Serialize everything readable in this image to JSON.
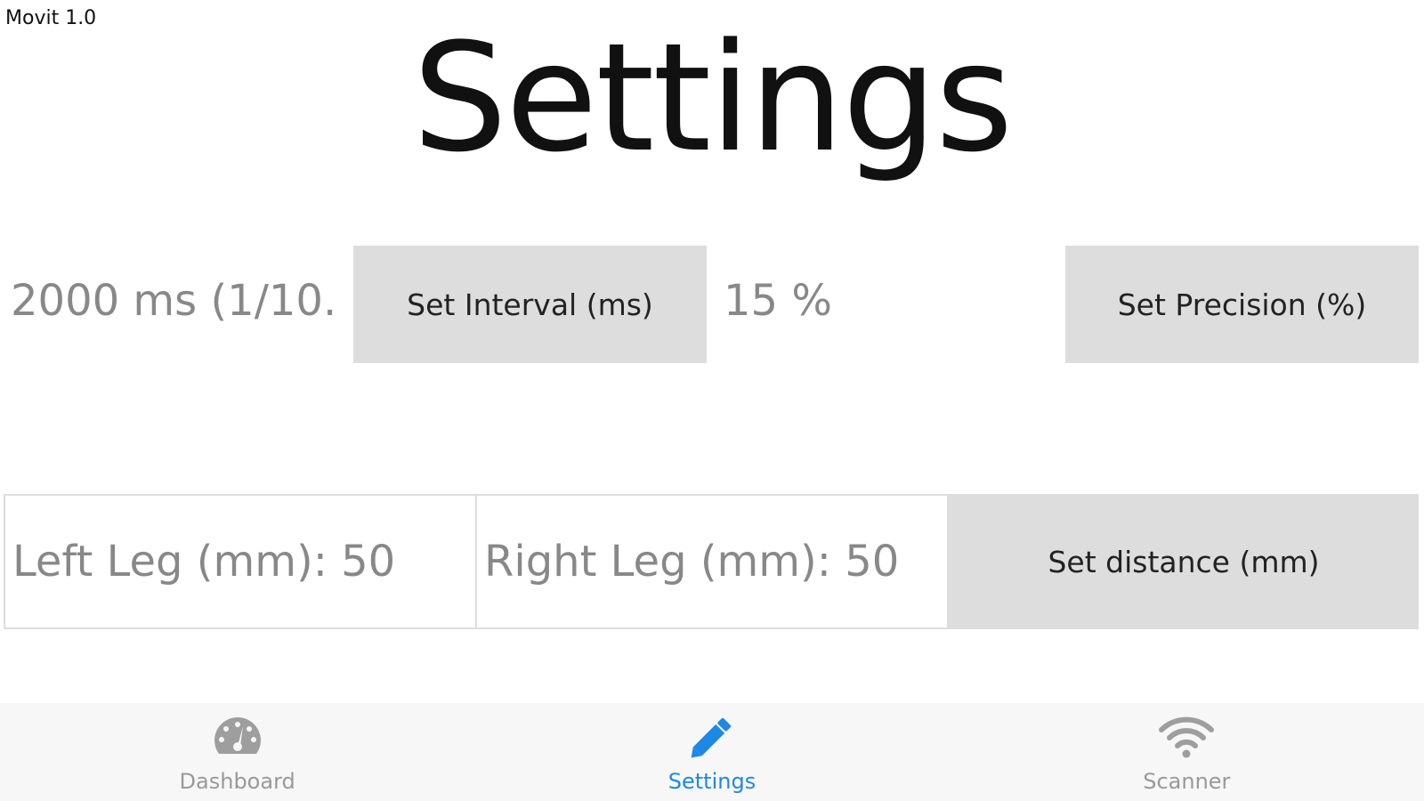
{
  "app": {
    "version_label": "Movit 1.0"
  },
  "page": {
    "title": "Settings"
  },
  "interval": {
    "value": "2000 ms (1/10...",
    "button_label": "Set Interval (ms)"
  },
  "precision": {
    "value": "15 %",
    "button_label": "Set Precision (%)"
  },
  "legs": {
    "left_value": "Left Leg (mm): 50",
    "right_value": "Right Leg (mm): 50",
    "button_label": "Set distance (mm)"
  },
  "bottom_nav": {
    "items": [
      {
        "label": "Dashboard",
        "icon": "speedometer-icon",
        "active": false
      },
      {
        "label": "Settings",
        "icon": "pencil-icon",
        "active": true
      },
      {
        "label": "Scanner",
        "icon": "wifi-icon",
        "active": false
      }
    ],
    "active_color": "#1E88E5",
    "inactive_color": "#999999"
  }
}
